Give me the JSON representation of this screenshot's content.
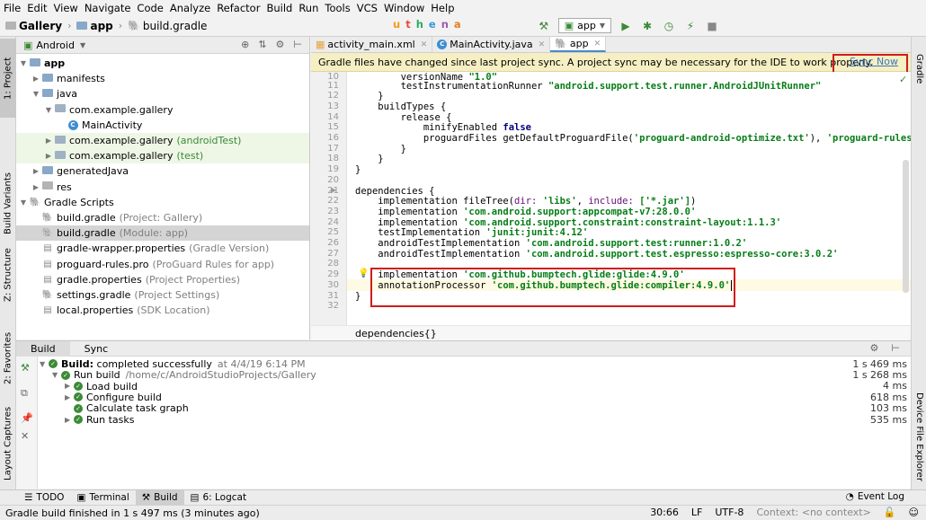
{
  "menu": [
    "File",
    "Edit",
    "View",
    "Navigate",
    "Code",
    "Analyze",
    "Refactor",
    "Build",
    "Run",
    "Tools",
    "VCS",
    "Window",
    "Help"
  ],
  "logo": {
    "text": "uthena",
    "colors": [
      "#f39c12",
      "#e74c3c",
      "#27ae60",
      "#3498db",
      "#9b59b6",
      "#e67e22"
    ]
  },
  "nav": {
    "crumbs": [
      "Gallery",
      "app",
      "build.gradle"
    ],
    "run_config": "app"
  },
  "left_stripe": {
    "project": "1: Project",
    "build_variants": "Build Variants",
    "structure": "Z: Structure",
    "favorites": "2: Favorites",
    "layout_captures": "Layout Captures"
  },
  "right_stripe": {
    "gradle": "Gradle",
    "device_explorer": "Device File Explorer"
  },
  "project": {
    "view": "Android",
    "rows": [
      {
        "label": "app",
        "sub": "",
        "bold": true
      },
      {
        "label": "manifests",
        "sub": ""
      },
      {
        "label": "java",
        "sub": ""
      },
      {
        "label": "com.example.gallery",
        "sub": ""
      },
      {
        "label": "MainActivity",
        "sub": ""
      },
      {
        "label": "com.example.gallery",
        "sub": "(androidTest)"
      },
      {
        "label": "com.example.gallery",
        "sub": "(test)"
      },
      {
        "label": "generatedJava",
        "sub": ""
      },
      {
        "label": "res",
        "sub": ""
      },
      {
        "label": "Gradle Scripts",
        "sub": ""
      },
      {
        "label": "build.gradle",
        "sub": "(Project: Gallery)"
      },
      {
        "label": "build.gradle",
        "sub": "(Module: app)"
      },
      {
        "label": "gradle-wrapper.properties",
        "sub": "(Gradle Version)"
      },
      {
        "label": "proguard-rules.pro",
        "sub": "(ProGuard Rules for app)"
      },
      {
        "label": "gradle.properties",
        "sub": "(Project Properties)"
      },
      {
        "label": "settings.gradle",
        "sub": "(Project Settings)"
      },
      {
        "label": "local.properties",
        "sub": "(SDK Location)"
      }
    ]
  },
  "editor_tabs": [
    "activity_main.xml",
    "MainActivity.java",
    "app"
  ],
  "banner": {
    "message": "Gradle files have changed since last project sync. A project sync may be necessary for the IDE to work properly.",
    "action": "Sync Now"
  },
  "code": {
    "line_numbers": [
      "10",
      "11",
      "12",
      "13",
      "14",
      "15",
      "16",
      "17",
      "18",
      "19",
      "20",
      "21",
      "22",
      "23",
      "24",
      "25",
      "26",
      "27",
      "28",
      "29",
      "30",
      "31",
      "32"
    ],
    "l10_a": "        versionName ",
    "l10_s": "\"1.0\"",
    "l11_a": "        testInstrumentationRunner ",
    "l11_s": "\"android.support.test.runner.AndroidJUnitRunner\"",
    "l12": "    }",
    "l13": "    buildTypes {",
    "l14": "        release {",
    "l15_a": "            minifyEnabled ",
    "l15_k": "false",
    "l16_a": "            proguardFiles getDefaultProguardFile(",
    "l16_s1": "'proguard-android-optimize.txt'",
    "l16_b": "), ",
    "l16_s2": "'proguard-rules.pro'",
    "l17": "        }",
    "l18": "    }",
    "l19": "}",
    "l20": "",
    "l21": "dependencies {",
    "l22_a": "    implementation fileTree(",
    "l22_k1": "dir: ",
    "l22_s1": "'libs'",
    "l22_b": ", ",
    "l22_k2": "include: ",
    "l22_s2": "['*.jar']",
    "l22_c": ")",
    "l23_a": "    implementation ",
    "l23_s": "'com.android.support:appcompat-v7:28.0.0'",
    "l24_a": "    implementation ",
    "l24_s": "'com.android.support.constraint:constraint-layout:1.1.3'",
    "l25_a": "    testImplementation ",
    "l25_s": "'junit:junit:4.12'",
    "l26_a": "    androidTestImplementation ",
    "l26_s": "'com.android.support.test:runner:1.0.2'",
    "l27_a": "    androidTestImplementation ",
    "l27_s": "'com.android.support.test.espresso:espresso-core:3.0.2'",
    "l28": "",
    "l29_a": "    implementation ",
    "l29_s": "'com.github.bumptech.glide:glide:4.9.0'",
    "l30_a": "    annotationProcessor ",
    "l30_s": "'com.github.bumptech.glide:compiler:4.9.0'",
    "l31": "}",
    "l32": ""
  },
  "breadcrumb": "dependencies{}",
  "build": {
    "tabs": [
      "Build",
      "Sync"
    ],
    "rows": [
      {
        "label": "Build:",
        "rest": "completed successfully",
        "muted": "at 4/4/19 6:14 PM",
        "time": "1 s 469 ms"
      },
      {
        "label": "Run build",
        "rest": "",
        "muted": "/home/c/AndroidStudioProjects/Gallery",
        "time": "1 s 268 ms"
      },
      {
        "label": "Load build",
        "rest": "",
        "muted": "",
        "time": "4 ms"
      },
      {
        "label": "Configure build",
        "rest": "",
        "muted": "",
        "time": "618 ms"
      },
      {
        "label": "Calculate task graph",
        "rest": "",
        "muted": "",
        "time": "103 ms"
      },
      {
        "label": "Run tasks",
        "rest": "",
        "muted": "",
        "time": "535 ms"
      }
    ]
  },
  "bottom_tabs": {
    "todo": "TODO",
    "terminal": "Terminal",
    "build": "Build",
    "logcat": "6: Logcat",
    "event_log": "Event Log"
  },
  "status": {
    "message": "Gradle build finished in 1 s 497 ms (3 minutes ago)",
    "position": "30:66",
    "line_sep": "LF",
    "encoding": "UTF-8",
    "context": "Context: <no context>"
  }
}
